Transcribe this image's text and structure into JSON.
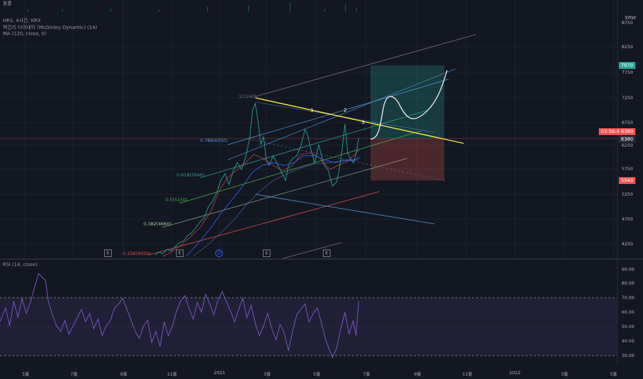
{
  "main": {
    "top_left_label": "볼륨",
    "legend": [
      "HRS, 4시간, KRX",
      "맥긴리 다이내믹 (McGinley Dynamic) (14)",
      "MA (120, close, 0)"
    ],
    "currency": "KRW",
    "price_axis": [
      "8750",
      "8250",
      "7750",
      "7250",
      "6750",
      "6250",
      "5750",
      "5250",
      "4750",
      "4250"
    ],
    "price_tags": {
      "target": "7870",
      "countdown": "03:56:40",
      "last": "6380",
      "last2": "6380",
      "stop": "5540"
    },
    "fib_levels": [
      {
        "label": "1(7240)",
        "color": "#787b86"
      },
      {
        "label": "0.786(6350)",
        "color": "#4c9fe6"
      },
      {
        "label": "0.618(5640)",
        "color": "#26a69a"
      },
      {
        "label": "0.5(5150)",
        "color": "#4caf50"
      },
      {
        "label": "0.382(4660)",
        "color": "#a5d6a7"
      },
      {
        "label": "0.236(4050)",
        "color": "#ef5350"
      }
    ],
    "wave_labels": [
      "1",
      "2",
      "3"
    ],
    "event_marks": [
      "E",
      "E",
      "D",
      "E",
      "E",
      "E"
    ]
  },
  "rsi": {
    "legend": "RSI (14, close)",
    "axis": [
      "90.00",
      "80.00",
      "70.00",
      "60.00",
      "50.00",
      "40.00",
      "30.00"
    ]
  },
  "time_axis": [
    "5월",
    "7월",
    "9월",
    "11월",
    "2021",
    "3월",
    "5월",
    "7월",
    "9월",
    "11월",
    "2022",
    "3월",
    "5월"
  ],
  "colors": {
    "background": "#131722",
    "up": "#26a69a",
    "down": "#ef5350",
    "rsi_line": "#7e57c2",
    "trendline": "#ffeb3b"
  }
}
